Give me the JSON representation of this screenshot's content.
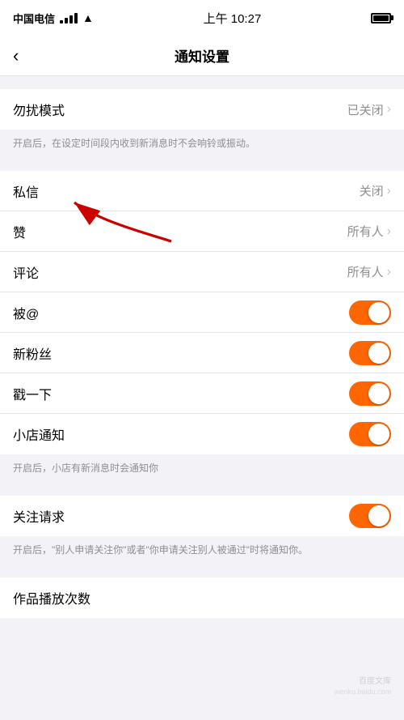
{
  "statusBar": {
    "carrier": "中国电信",
    "time": "上午 10:27",
    "batteryFull": true
  },
  "navBar": {
    "title": "通知设置",
    "backLabel": "‹"
  },
  "sections": [
    {
      "id": "dnd",
      "rows": [
        {
          "id": "dnd-mode",
          "label": "勿扰模式",
          "value": "已关闭",
          "type": "nav"
        }
      ],
      "description": "开启后，在设定时间段内收到新消息时不会响铃或振动。"
    },
    {
      "id": "social",
      "rows": [
        {
          "id": "dm",
          "label": "私信",
          "value": "关闭",
          "type": "nav"
        },
        {
          "id": "like",
          "label": "赞",
          "value": "所有人",
          "type": "nav"
        },
        {
          "id": "comment",
          "label": "评论",
          "value": "所有人",
          "type": "nav"
        },
        {
          "id": "at",
          "label": "被@",
          "value": null,
          "type": "toggle",
          "on": true
        },
        {
          "id": "new-fans",
          "label": "新粉丝",
          "value": null,
          "type": "toggle",
          "on": true
        },
        {
          "id": "zhan",
          "label": "戳一下",
          "value": null,
          "type": "toggle",
          "on": true
        },
        {
          "id": "shop-notify",
          "label": "小店通知",
          "value": null,
          "type": "toggle",
          "on": true
        }
      ],
      "description": "开启后，小店有新消息时会通知你"
    },
    {
      "id": "follow",
      "rows": [
        {
          "id": "follow-request",
          "label": "关注请求",
          "value": null,
          "type": "toggle",
          "on": true
        }
      ],
      "description": "开启后，\"别人申请关注你\"或者\"你申请关注别人被通过\"时将通知你。"
    },
    {
      "id": "plays",
      "rows": [
        {
          "id": "play-count",
          "label": "作品播放次数",
          "value": null,
          "type": "toggle-placeholder"
        }
      ],
      "description": null
    }
  ],
  "arrow": {
    "visible": true
  },
  "watermark": {
    "text": "百度文库"
  }
}
